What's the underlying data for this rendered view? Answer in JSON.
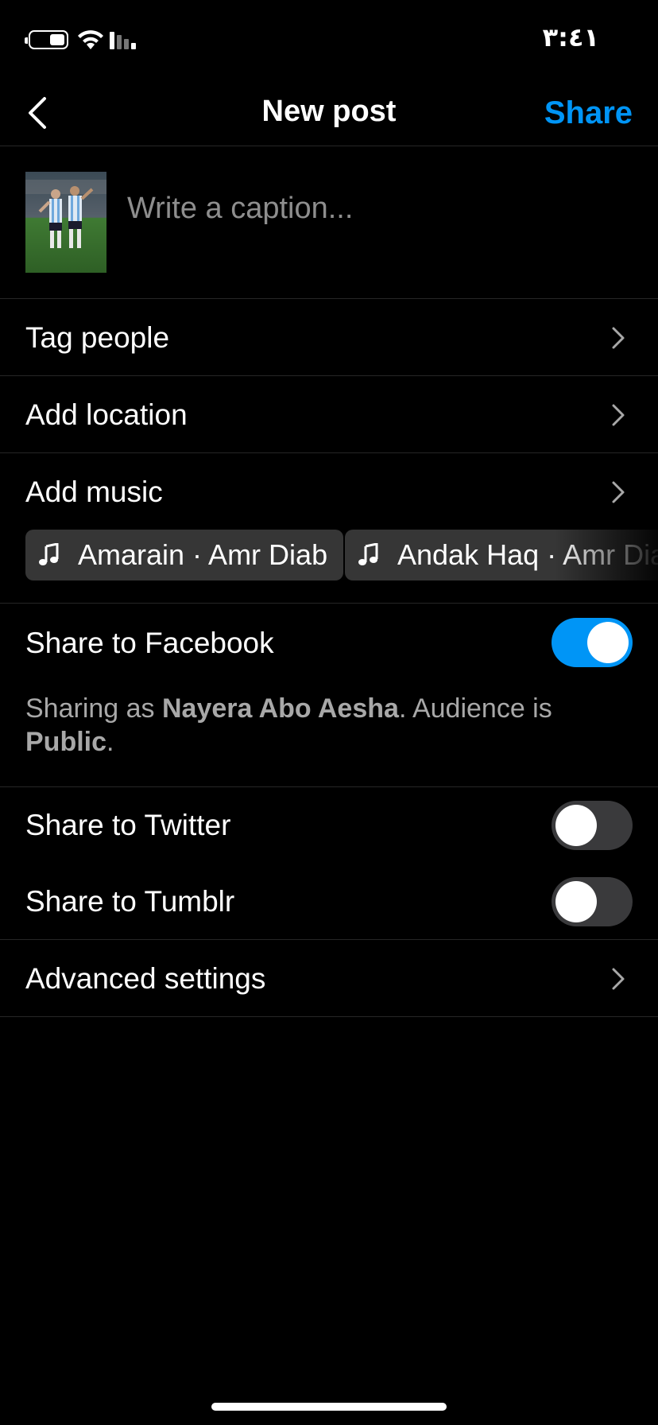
{
  "status_bar": {
    "time": "٣:٤١"
  },
  "header": {
    "title": "New post",
    "share_label": "Share"
  },
  "caption": {
    "placeholder": "Write a caption..."
  },
  "rows": {
    "tag_people": "Tag people",
    "add_location": "Add location",
    "add_music": "Add music",
    "share_facebook": "Share to Facebook",
    "share_twitter": "Share to Twitter",
    "share_tumblr": "Share to Tumblr",
    "advanced_settings": "Advanced settings"
  },
  "music_suggestions": [
    {
      "label": "Amarain · Amr Diab"
    },
    {
      "label": "Andak Haq · Amr Diab"
    }
  ],
  "sharing_note": {
    "prefix": "Sharing as ",
    "name": "Nayera Abo Aesha",
    "middle": ". Audience is ",
    "audience": "Public",
    "suffix": "."
  },
  "toggles": {
    "facebook": true,
    "twitter": false,
    "tumblr": false
  },
  "colors": {
    "accent": "#0095f6",
    "background": "#000000",
    "chip": "#363636",
    "muted_text": "#a8a8a8"
  }
}
